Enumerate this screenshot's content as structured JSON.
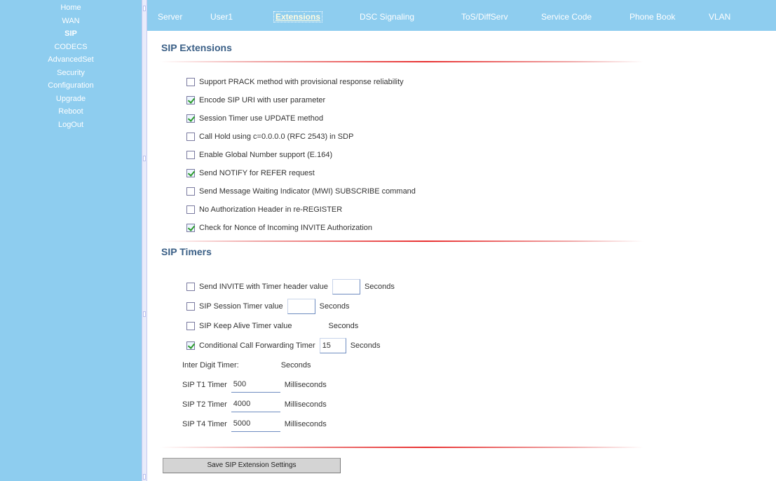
{
  "nav": {
    "items": [
      {
        "label": "Home",
        "active": false
      },
      {
        "label": "WAN",
        "active": false
      },
      {
        "label": "SIP",
        "active": true
      },
      {
        "label": "CODECS",
        "active": false
      },
      {
        "label": "AdvancedSet",
        "active": false
      },
      {
        "label": "Security",
        "active": false
      },
      {
        "label": "Configuration",
        "active": false
      },
      {
        "label": "Upgrade",
        "active": false
      },
      {
        "label": "Reboot",
        "active": false
      },
      {
        "label": "LogOut",
        "active": false
      }
    ]
  },
  "tabs": [
    {
      "label": "Server",
      "active": false
    },
    {
      "label": "User1",
      "active": false
    },
    {
      "label": "Extensions",
      "active": true
    },
    {
      "label": "DSC Signaling",
      "active": false
    },
    {
      "label": "ToS/DiffServ",
      "active": false
    },
    {
      "label": "Service Code",
      "active": false
    },
    {
      "label": "Phone Book",
      "active": false
    },
    {
      "label": "VLAN",
      "active": false
    }
  ],
  "extensions": {
    "title": "SIP Extensions",
    "options": [
      {
        "label": "Support PRACK method with provisional response reliability",
        "checked": false
      },
      {
        "label": "Encode SIP URI with user parameter",
        "checked": true
      },
      {
        "label": "Session Timer use UPDATE method",
        "checked": true
      },
      {
        "label": "Call Hold using c=0.0.0.0 (RFC 2543) in SDP",
        "checked": false
      },
      {
        "label": "Enable Global Number support (E.164)",
        "checked": false
      },
      {
        "label": "Send NOTIFY for REFER request",
        "checked": true
      },
      {
        "label": "Send Message Waiting Indicator (MWI) SUBSCRIBE command",
        "checked": false
      },
      {
        "label": "No Authorization Header in re-REGISTER",
        "checked": false
      },
      {
        "label": "Check for Nonce of Incoming INVITE Authorization",
        "checked": true
      }
    ]
  },
  "timers": {
    "title": "SIP Timers",
    "min_se": {
      "label": "Send INVITE with Timer header value",
      "checked": false,
      "value": "",
      "unit": "Seconds"
    },
    "session_timer": {
      "label": "SIP Session Timer value",
      "checked": false,
      "value": "",
      "unit": "Seconds"
    },
    "keep_alive": {
      "label": "SIP Keep Alive Timer value",
      "checked": false,
      "value": "",
      "unit": "Seconds"
    },
    "cond_forward": {
      "label": "Conditional Call Forwarding Timer",
      "checked": true,
      "value": "15",
      "unit": "Seconds"
    },
    "inter_digit": {
      "label": "Inter Digit Timer:",
      "value": "",
      "unit": "Seconds"
    },
    "t1": {
      "label": "SIP T1 Timer",
      "value": "500",
      "unit": "Milliseconds"
    },
    "t2": {
      "label": "SIP T2 Timer",
      "value": "4000",
      "unit": "Milliseconds"
    },
    "t4": {
      "label": "SIP T4 Timer",
      "value": "5000",
      "unit": "Milliseconds"
    }
  },
  "save_button": "Save SIP Extension Settings",
  "colors": {
    "nav_bg": "#8ecdef",
    "section_title": "#3a5f86",
    "rule_accent": "#e83030",
    "check_mark": "#2a9a2a"
  }
}
